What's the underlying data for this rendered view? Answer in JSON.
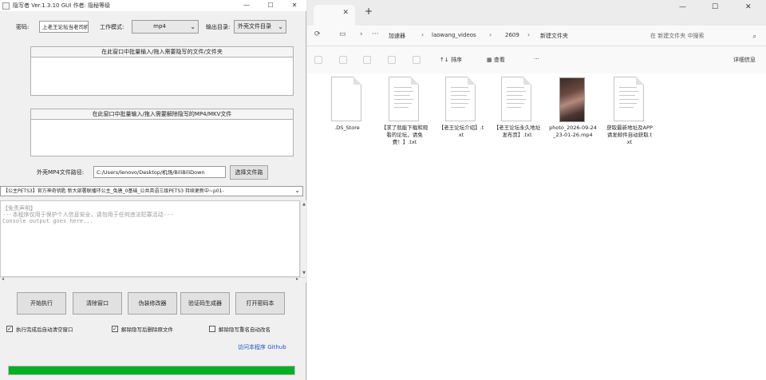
{
  "app": {
    "title": "隐写者 Ver.1.3.10 GUI 作者: 隐秘等级",
    "window_controls": {
      "minimize": "—",
      "maximize": "☐",
      "close": "✕"
    },
    "password_label": "密码:",
    "password_value": "上老王论坛当老司机",
    "work_mode_label": "工作模式:",
    "work_mode_value": "mp4",
    "output_dir_label": "输出目录:",
    "output_dir_value": "外壳文件目录",
    "hide_panel_header": "在此窗口中批量输入/拖入需要隐写的文件/文件夹",
    "extract_panel_header": "在此窗口中批量输入/拖入需要解除隐写的MP4/MKV文件",
    "shell_file_label": "外壳MP4文件路径:",
    "shell_file_path": "C:/Users/lenovo/Desktop/机场/BiliBiliDown",
    "choose_file_button": "选择文件路",
    "shell_file_select": "【公主PETS3】官方神奇钥匙 新大部署联播环公主_兔唐_0基础_公共英语三级PETS3 持续更新中~p01-",
    "console_lines": [
      "【免责声明】",
      "---本程序仅用于保护个人信息安全，请勿用于任何违法犯罪活动---",
      "Console output goes here..."
    ],
    "buttons": {
      "start": "开始执行",
      "clear": "清除窗口",
      "disguiser": "伪装修改器",
      "password_gen": "验证码生成器",
      "open_password_file": "打开密码本"
    },
    "checkboxes": [
      {
        "label": "执行完成后自动清空窗口",
        "checked": true
      },
      {
        "label": "解除隐写后删除原文件",
        "checked": true
      },
      {
        "label": "解除隐写重名自动改名",
        "checked": false
      }
    ],
    "github_link": "访问本程序 Github",
    "progress": 1.0,
    "progress_color": "#06b025"
  },
  "explorer": {
    "tab_close": "✕",
    "new_tab": "+",
    "window_controls": {
      "minimize": "—",
      "maximize": "☐",
      "close": "✕"
    },
    "nav": {
      "refresh": "⟳",
      "view": "▭",
      "forward": "›",
      "more": "···"
    },
    "breadcrumbs": [
      "加速器",
      "laowang_videos",
      "2609",
      "新建文件夹"
    ],
    "breadcrumb_separator": "›",
    "search_placeholder": "在 新建文件夹 中搜索",
    "search_icon": "⌕",
    "command_bar": {
      "sort": "↑↓ 排序",
      "view": "查看",
      "more": "···",
      "details": "详细信息"
    },
    "files": [
      {
        "name": ".DS_Store",
        "kind": "blank"
      },
      {
        "name": "【求了就能下载和观看的论坛，请免费！】.txt",
        "kind": "text"
      },
      {
        "name": "【老王论坛介绍】.txt",
        "kind": "text"
      },
      {
        "name": "【老王论坛永久地址发布页】.txt",
        "kind": "text"
      },
      {
        "name": "photo_2026-09-24_23-01-26.mp4",
        "kind": "video"
      },
      {
        "name": "获取最新地址及APP请发邮件自动获取.txt",
        "kind": "text"
      }
    ]
  }
}
